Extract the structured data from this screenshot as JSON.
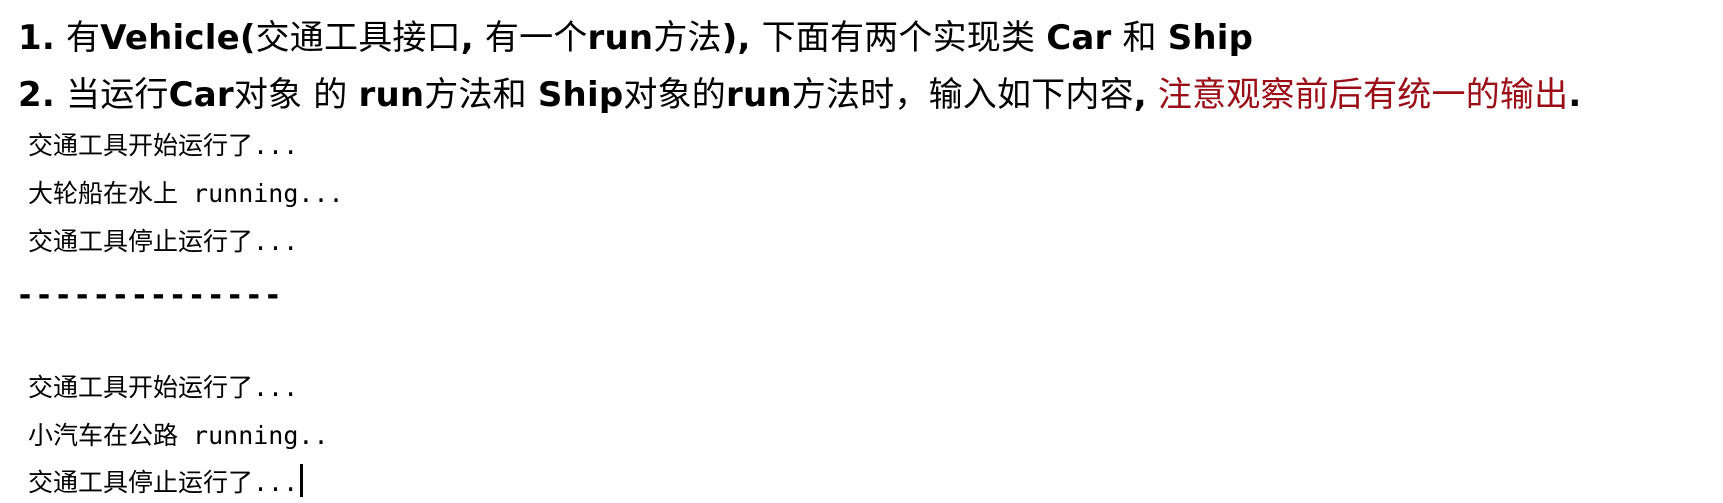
{
  "requirements": {
    "line1": {
      "num": "1.",
      "t1": "有",
      "t2": "Vehicle(",
      "t3": "交通工具接口",
      "t4": ",",
      "t5": " 有一个",
      "t6": "run",
      "t7": "方法",
      "t8": "),",
      "t9": " 下面有两个实现类 ",
      "t10": "Car",
      "t11": " 和 ",
      "t12": " Ship"
    },
    "line2": {
      "num": "2.",
      "t1": " 当运行",
      "t2": "Car",
      "t3": "对象 的 ",
      "t4": "run",
      "t5": "方法和 ",
      "t6": "Ship",
      "t7": "对象的",
      "t8": "run",
      "t9": "方法时，输入如下内容",
      "t10": ",",
      "t11": " 注意观察前后有统一的输出",
      "t12": "."
    }
  },
  "output": {
    "ship_block": [
      "交通工具开始运行了...",
      "大轮船在水上 running...",
      "交通工具停止运行了..."
    ],
    "separator": "--------------",
    "car_block": [
      "交通工具开始运行了...",
      "小汽车在公路 running..",
      "交通工具停止运行了..."
    ]
  },
  "colors": {
    "highlight": "#9b0d16",
    "text": "#000000",
    "background": "#ffffff"
  }
}
